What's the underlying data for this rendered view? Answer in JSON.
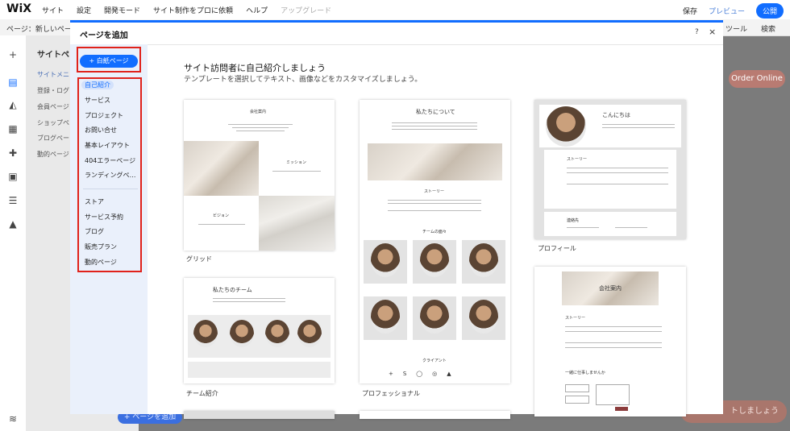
{
  "topbar": {
    "logo": "WiX",
    "menu": [
      "サイト",
      "設定",
      "開発モード",
      "サイト制作をプロに依頼",
      "ヘルプ"
    ],
    "upgrade": "アップグレード",
    "save": "保存",
    "preview": "プレビュー",
    "publish": "公開"
  },
  "subbar": {
    "page_label": "ページ：新しいページ",
    "tools": "ツール",
    "search": "検索"
  },
  "bg_panel": {
    "title": "サイトペ",
    "items": [
      "サイトメニ",
      "登録・ログ",
      "会員ページ",
      "ショップペ",
      "ブログペー",
      "動的ページ"
    ]
  },
  "bg_buttons": {
    "order_online": "Order Online",
    "contact": "トしましょう",
    "add_page": "+ ページを追加"
  },
  "modal": {
    "title": "ページを追加",
    "help": "?",
    "close": "×",
    "blank_page": "+ 白紙ページ",
    "nav_group1": [
      "自己紹介",
      "サービス",
      "プロジェクト",
      "お問い合せ",
      "基本レイアウト",
      "404エラーページ",
      "ランディングペ…"
    ],
    "nav_group2": [
      "ストア",
      "サービス予約",
      "ブログ",
      "販売プラン",
      "動的ページ"
    ],
    "heading": "サイト訪問者に自己紹介しましょう",
    "subheading": "テンプレートを選択してテキスト、画像などをカスタマイズしましょう。"
  },
  "templates": {
    "grid": {
      "caption": "グリッド",
      "title": "会社案内",
      "mission": "ミッション",
      "vision": "ビジョン"
    },
    "professional": {
      "caption": "プロフェッショナル",
      "title": "私たちについて",
      "story": "ストーリー",
      "team": "チームの面々",
      "clients": "クライアント"
    },
    "profile": {
      "caption": "プロフィール",
      "hello": "こんにちは",
      "story": "ストーリー",
      "contact": "連絡先"
    },
    "team": {
      "caption": "チーム紹介",
      "title": "私たちのチーム"
    },
    "company": {
      "title": "会社案内",
      "story": "ストーリー",
      "cta": "一緒に仕事しませんか"
    }
  },
  "colors": {
    "accent": "#116dff",
    "highlight_border": "#e0221b",
    "sidebar_bg": "#eaf0fb"
  }
}
